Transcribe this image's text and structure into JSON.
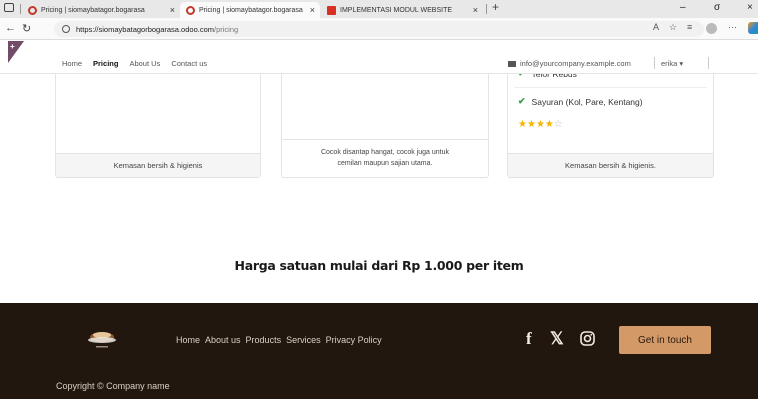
{
  "browser": {
    "tabs": [
      {
        "title": "Pricing | siomaybatagor.bogarasa",
        "active": false
      },
      {
        "title": "Pricing | siomaybatagor.bogarasa",
        "active": true
      },
      {
        "title": "IMPLEMENTASI MODUL WEBSITE",
        "active": false
      }
    ],
    "new_tab": "+",
    "url_host": "https://siomaybatagorbogarasa.odoo.com",
    "url_path": "/pricing",
    "window_controls": [
      "–",
      "σ",
      "×"
    ]
  },
  "header": {
    "nav": [
      "Home",
      "Pricing",
      "About Us",
      "Contact us"
    ],
    "active_nav": "Pricing",
    "email": "info@yourcompany.example.com",
    "user": "erika ▾"
  },
  "cards": {
    "left_footer": "Kemasan bersih & higienis",
    "middle_desc_1": "Cocok disantap hangat, cocok juga untuk",
    "middle_desc_2": "cemilan maupun sajian utama.",
    "right_items": [
      "Telor Rebus",
      "Sayuran (Kol, Pare, Kentang)"
    ],
    "right_rating": 4,
    "right_rating_max": 5,
    "right_footer": "Kemasan bersih & higienis."
  },
  "headline": "Harga satuan mulai dari Rp 1.000 per item",
  "footer": {
    "links": [
      "Home",
      "About us",
      "Products",
      "Services",
      "Privacy Policy"
    ],
    "social": [
      "facebook",
      "x",
      "instagram"
    ],
    "cta": "Get in touch",
    "copyright": "Copyright © Company name"
  },
  "colors": {
    "footer_bg": "#21170e",
    "cta_bg": "#d39a68",
    "check_green": "#2e9e43",
    "star_gold": "#f4b400"
  }
}
